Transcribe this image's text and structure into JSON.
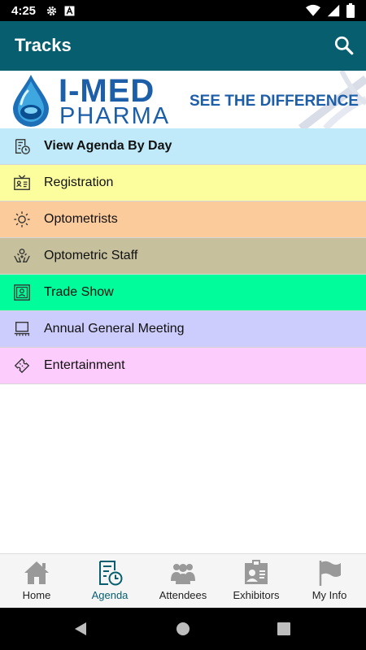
{
  "status_bar": {
    "time": "4:25",
    "icons": [
      "gear-icon",
      "a-icon",
      "wifi-icon",
      "signal-icon",
      "battery-icon"
    ]
  },
  "app_bar": {
    "title": "Tracks",
    "search_icon": "search-icon",
    "background": "#075e6f"
  },
  "banner": {
    "brand_line1": "I-MED",
    "brand_line2": "PHARMA",
    "tagline": "SEE THE DIFFERENCE",
    "brand_color": "#1d5ea8"
  },
  "tracks": [
    {
      "label": "View Agenda By Day",
      "icon": "calendar-clock-icon",
      "color": "#c0eaf9",
      "bold": true
    },
    {
      "label": "Registration",
      "icon": "id-card-icon",
      "color": "#fcfe9d"
    },
    {
      "label": "Optometrists",
      "icon": "sun-icon",
      "color": "#fccb9b"
    },
    {
      "label": "Optometric Staff",
      "icon": "hands-icon",
      "color": "#c6c09d"
    },
    {
      "label": "Trade Show",
      "icon": "booth-icon",
      "color": "#00fc9b"
    },
    {
      "label": "Annual General Meeting",
      "icon": "podium-icon",
      "color": "#cccdfc"
    },
    {
      "label": "Entertainment",
      "icon": "ticket-icon",
      "color": "#fcccfc"
    }
  ],
  "bottom_nav": {
    "active": "Agenda",
    "active_color": "#075e6f",
    "items": [
      {
        "label": "Home",
        "icon": "home-icon"
      },
      {
        "label": "Agenda",
        "icon": "agenda-icon"
      },
      {
        "label": "Attendees",
        "icon": "attendees-icon"
      },
      {
        "label": "Exhibitors",
        "icon": "exhibitors-icon"
      },
      {
        "label": "My Info",
        "icon": "flag-icon"
      }
    ]
  },
  "system_nav": {
    "icons": [
      "back-icon",
      "home-circle-icon",
      "recents-icon"
    ]
  }
}
